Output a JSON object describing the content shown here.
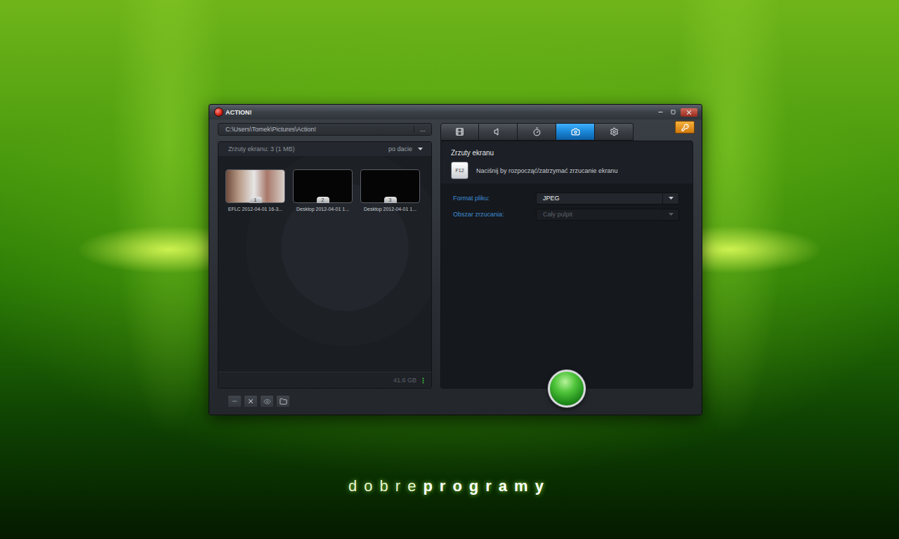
{
  "window": {
    "title": "ACTION!"
  },
  "path": {
    "value": "C:\\Users\\Tomek\\Pictures\\Action!",
    "browse": "..."
  },
  "gallery": {
    "header": "Zrzuty ekranu: 3 (1 MB)",
    "sort": "po dacie",
    "items": [
      {
        "number": "1",
        "label": "EFLC 2012-04-01 16-3...",
        "kind": "photo"
      },
      {
        "number": "2",
        "label": "Desktop 2012-04-01 1...",
        "kind": "blank"
      },
      {
        "number": "3",
        "label": "Desktop 2012-04-01 1...",
        "kind": "blank"
      }
    ],
    "disk": "41.6 GB"
  },
  "tabs": [
    {
      "kind": "video",
      "selected": false
    },
    {
      "kind": "audio",
      "selected": false
    },
    {
      "kind": "timer",
      "selected": false
    },
    {
      "kind": "screenshot",
      "selected": true
    },
    {
      "kind": "settings",
      "selected": false
    }
  ],
  "screenshot": {
    "title": "Zrzuty ekranu",
    "hotkey": "F12",
    "hint": "Naciśnij by rozpocząć/zatrzymać zrzucanie ekranu",
    "settings": [
      {
        "label": "Format pliku:",
        "value": "JPEG",
        "disabled": false
      },
      {
        "label": "Obszar zrzucania:",
        "value": "Cały pulpit",
        "disabled": true
      }
    ]
  },
  "logo": {
    "light": "dobre",
    "bold": "programy"
  }
}
